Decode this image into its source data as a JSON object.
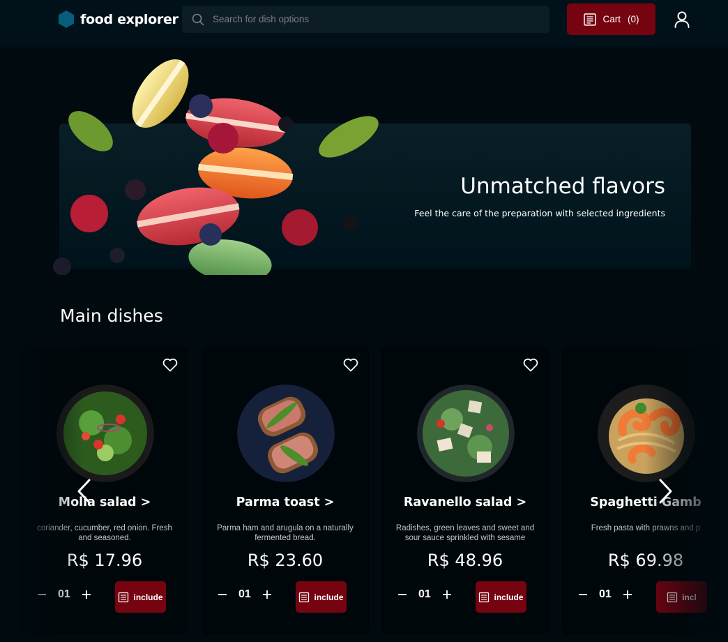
{
  "header": {
    "brand": "food explorer",
    "search_placeholder": "Search for dish options",
    "cart_label": "Cart",
    "cart_count": "(0)"
  },
  "banner": {
    "title": "Unmatched flavors",
    "subtitle": "Feel the care of the preparation with selected ingredients"
  },
  "section": {
    "title": "Main dishes"
  },
  "dishes": [
    {
      "name": "Molla salad >",
      "description": "coriander, cucumber, red onion. Fresh and seasoned.",
      "price": "R$ 17.96",
      "quantity": "01",
      "button": "include"
    },
    {
      "name": "Parma toast >",
      "description": "Parma ham and arugula on a naturally fermented bread.",
      "price": "R$ 23.60",
      "quantity": "01",
      "button": "include"
    },
    {
      "name": "Ravanello salad >",
      "description": "Radishes, green leaves and sweet and sour sauce sprinkled with sesame",
      "price": "R$ 48.96",
      "quantity": "01",
      "button": "include"
    },
    {
      "name": "Spaghetti Gamb",
      "description": "Fresh pasta with prawns and p",
      "price": "R$ 69.98",
      "quantity": "01",
      "button": "incl"
    }
  ],
  "colors": {
    "background": "#000a0f",
    "header": "#00111a",
    "accent": "#750310",
    "banner": "#091e26"
  },
  "icons": {
    "logo": "hexagon-icon",
    "search": "search-icon",
    "cart": "receipt-icon",
    "user": "user-icon",
    "favorite": "heart-icon",
    "prev": "chevron-left-icon",
    "next": "chevron-right-icon"
  }
}
